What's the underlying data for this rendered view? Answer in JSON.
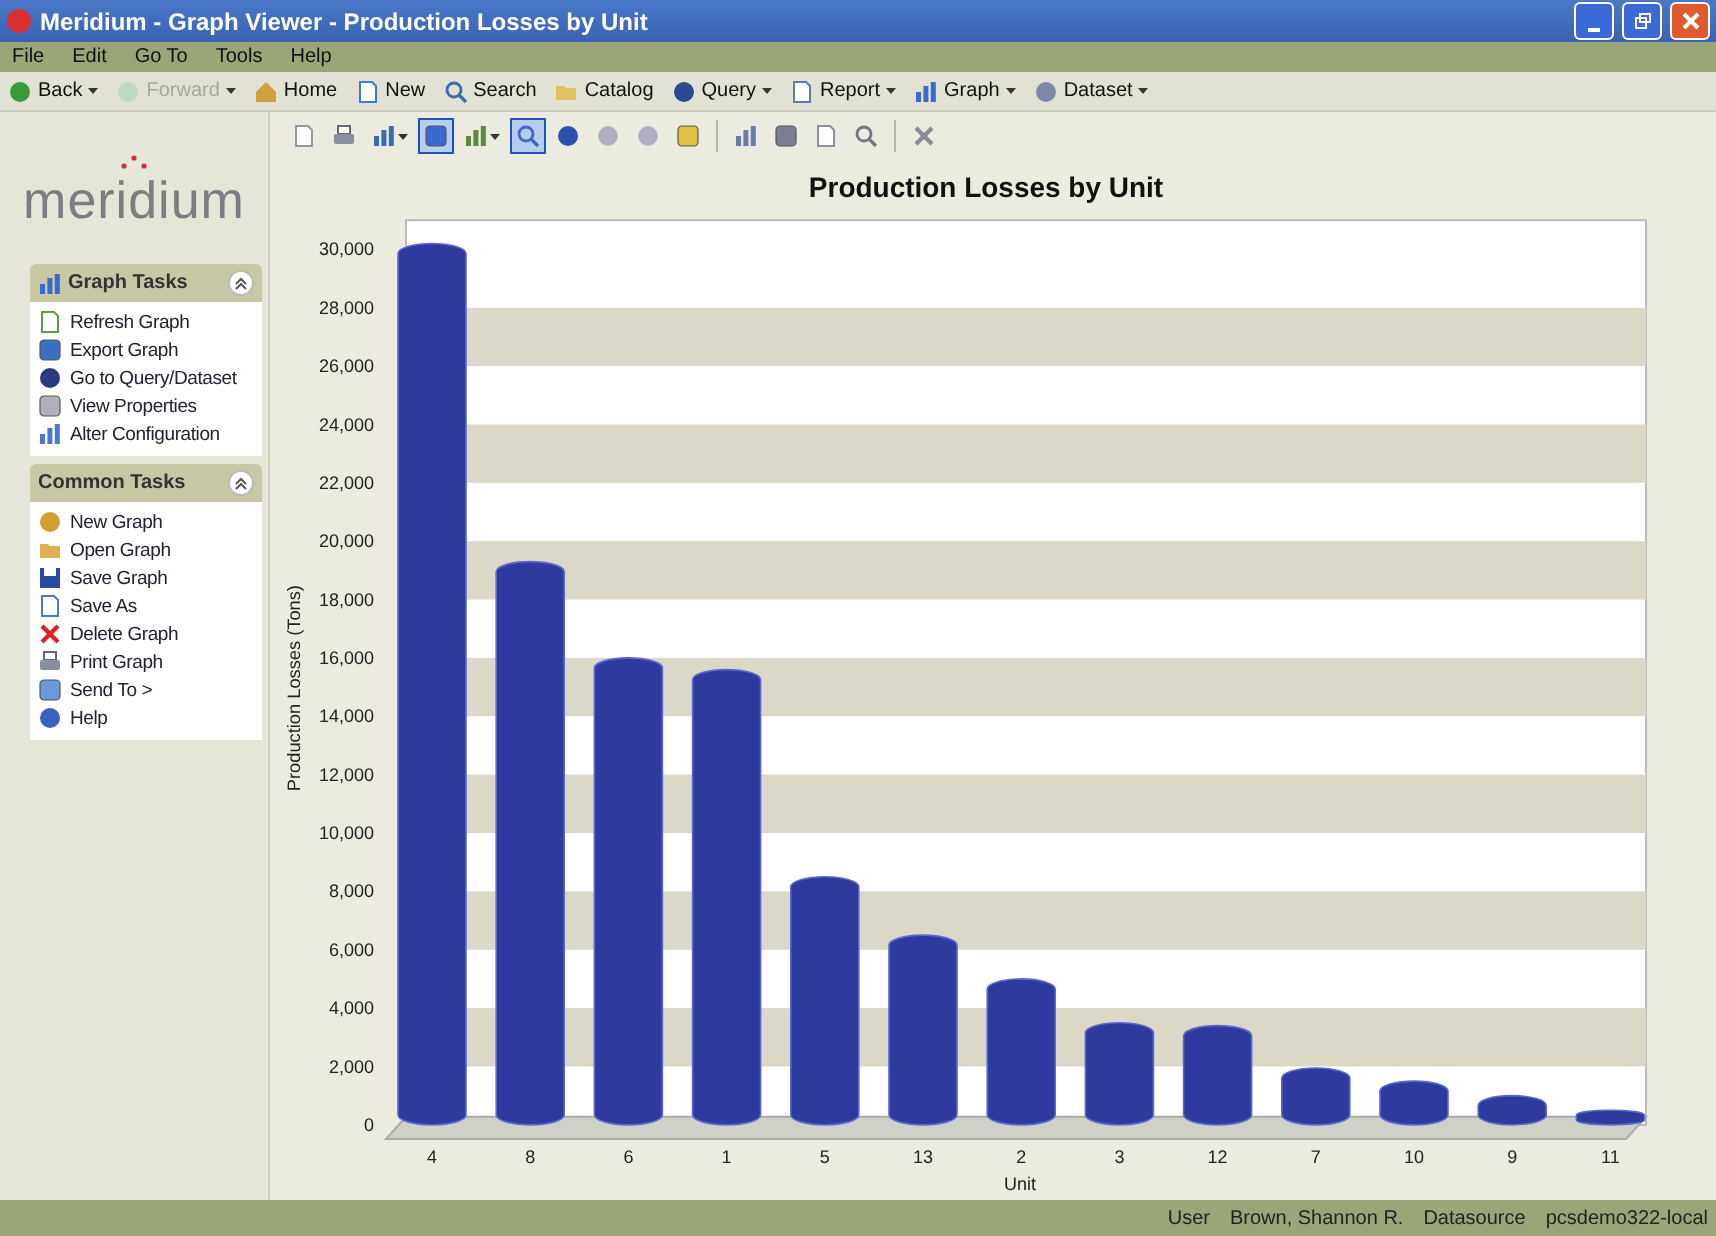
{
  "window": {
    "title": "Meridium - Graph Viewer - Production Losses by Unit"
  },
  "menu": [
    "File",
    "Edit",
    "Go To",
    "Tools",
    "Help"
  ],
  "nav_toolbar": [
    {
      "label": "Back",
      "dropdown": true,
      "disabled": false
    },
    {
      "label": "Forward",
      "dropdown": true,
      "disabled": true
    },
    {
      "label": "Home",
      "dropdown": false,
      "disabled": false
    },
    {
      "label": "New",
      "dropdown": false,
      "disabled": false
    },
    {
      "label": "Search",
      "dropdown": false,
      "disabled": false
    },
    {
      "label": "Catalog",
      "dropdown": false,
      "disabled": false
    },
    {
      "label": "Query",
      "dropdown": true,
      "disabled": false
    },
    {
      "label": "Report",
      "dropdown": true,
      "disabled": false
    },
    {
      "label": "Graph",
      "dropdown": true,
      "disabled": false
    },
    {
      "label": "Dataset",
      "dropdown": true,
      "disabled": false
    }
  ],
  "logo": "meridium",
  "task_panels": [
    {
      "title": "Graph Tasks",
      "expanded": true,
      "items": [
        "Refresh Graph",
        "Export Graph",
        "Go to Query/Dataset",
        "View Properties",
        "Alter Configuration"
      ]
    },
    {
      "title": "Common Tasks",
      "expanded": true,
      "items": [
        "New Graph",
        "Open Graph",
        "Save Graph",
        "Save As",
        "Delete Graph",
        "Print Graph",
        "Send To >",
        "Help"
      ]
    }
  ],
  "chart_toolbar": [
    {
      "kind": "button",
      "pressed": false
    },
    {
      "kind": "button",
      "pressed": false
    },
    {
      "kind": "dropdown",
      "pressed": false
    },
    {
      "kind": "button",
      "pressed": true
    },
    {
      "kind": "dropdown",
      "pressed": false
    },
    {
      "kind": "button",
      "pressed": true
    },
    {
      "kind": "button",
      "pressed": false
    },
    {
      "kind": "button",
      "pressed": false
    },
    {
      "kind": "button",
      "pressed": false
    },
    {
      "kind": "button",
      "pressed": false
    },
    {
      "kind": "separator"
    },
    {
      "kind": "button",
      "pressed": false
    },
    {
      "kind": "button",
      "pressed": false
    },
    {
      "kind": "button",
      "pressed": false
    },
    {
      "kind": "button",
      "pressed": false
    },
    {
      "kind": "separator"
    },
    {
      "kind": "button",
      "pressed": false
    }
  ],
  "chart_data": {
    "type": "bar",
    "title": "Production Losses by Unit",
    "xlabel": "Unit",
    "ylabel": "Production Losses (Tons)",
    "categories": [
      "4",
      "8",
      "6",
      "1",
      "5",
      "13",
      "2",
      "3",
      "12",
      "7",
      "10",
      "9",
      "11"
    ],
    "values": [
      30200,
      19300,
      16000,
      15600,
      8500,
      6500,
      5000,
      3500,
      3400,
      1950,
      1500,
      1000,
      500
    ],
    "ylim": [
      0,
      31000
    ],
    "yticks": [
      {
        "value": 0,
        "label": "0"
      },
      {
        "value": 2000,
        "label": "2,000"
      },
      {
        "value": 4000,
        "label": "4,000"
      },
      {
        "value": 6000,
        "label": "6,000"
      },
      {
        "value": 8000,
        "label": "8,000"
      },
      {
        "value": 10000,
        "label": "10,000"
      },
      {
        "value": 12000,
        "label": "12,000"
      },
      {
        "value": 14000,
        "label": "14,000"
      },
      {
        "value": 16000,
        "label": "16,000"
      },
      {
        "value": 18000,
        "label": "18,000"
      },
      {
        "value": 20000,
        "label": "20,000"
      },
      {
        "value": 22000,
        "label": "22,000"
      },
      {
        "value": 24000,
        "label": "24,000"
      },
      {
        "value": 26000,
        "label": "26,000"
      },
      {
        "value": 28000,
        "label": "28,000"
      },
      {
        "value": 30000,
        "label": "30,000"
      }
    ]
  },
  "status_bar": [
    {
      "label": "User",
      "value": "Brown, Shannon R."
    },
    {
      "label": "Datasource",
      "value": "pcsdemo322-local"
    }
  ]
}
